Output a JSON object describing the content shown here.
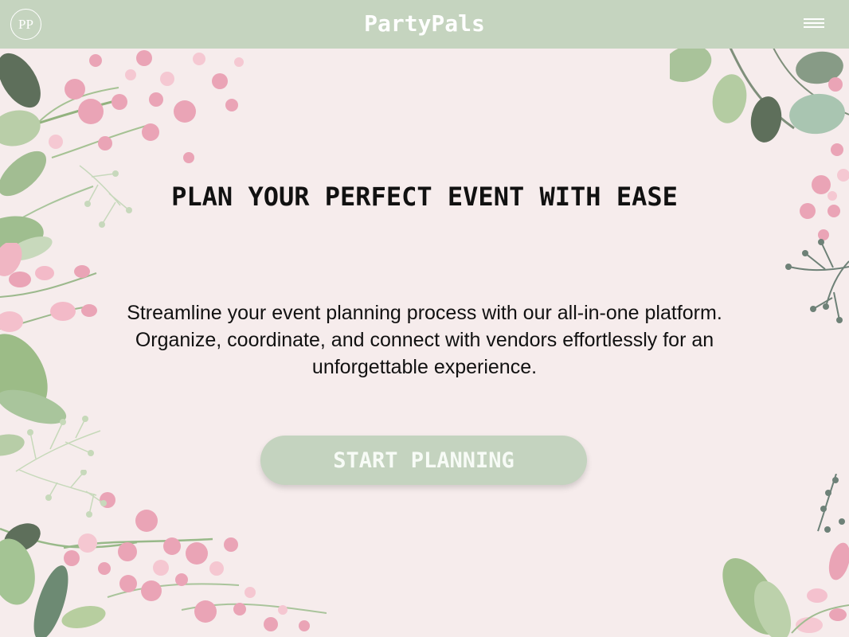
{
  "app": {
    "logo_initials": "PP",
    "brand_title": "PartyPals"
  },
  "header": {
    "menu_icon": "hamburger-menu-icon"
  },
  "hero": {
    "title": "PLAN YOUR PERFECT EVENT WITH EASE",
    "subtitle": "Streamline your event planning process with our all-in-one platform. Organize, coordinate, and connect with vendors effortlessly for an unforgettable experience.",
    "cta_label": "START PLANNING"
  },
  "decorations": {
    "icons": [
      "floral-border-top-left",
      "floral-border-top-right",
      "floral-border-left",
      "floral-border-bottom-left",
      "floral-border-bottom-right"
    ]
  },
  "colors": {
    "header_background": "#c5d4bf",
    "page_background": "#f6ecec",
    "button_background": "#c4d3bf",
    "text": "#111111",
    "flower_pink": "#eaa4b6",
    "leaf_green": "#9fbe8f",
    "dark_leaf": "#5e6f5b"
  }
}
